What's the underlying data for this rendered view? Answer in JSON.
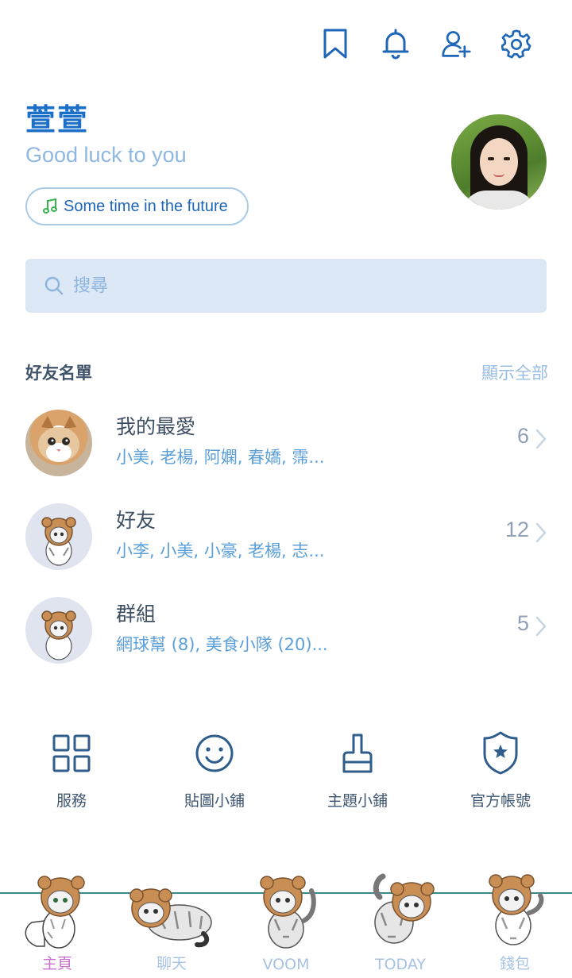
{
  "header": {
    "icons": [
      "bookmark-icon",
      "bell-icon",
      "add-friend-icon",
      "gear-icon"
    ]
  },
  "profile": {
    "name": "萱萱",
    "status": "Good luck to you",
    "music": "Some time in the future"
  },
  "search": {
    "placeholder": "搜尋"
  },
  "friends_section": {
    "title": "好友名單",
    "show_all": "顯示全部",
    "rows": [
      {
        "name": "我的最愛",
        "members": "小美, 老楊, 阿嫻, 春嬌, 霈...",
        "count": "6"
      },
      {
        "name": "好友",
        "members": "小李, 小美, 小豪, 老楊, 志...",
        "count": "12"
      },
      {
        "name": "群組",
        "members": "網球幫 (8), 美食小隊 (20)...",
        "count": "5"
      }
    ]
  },
  "shortcuts": [
    {
      "label": "服務",
      "icon": "grid-icon"
    },
    {
      "label": "貼圖小鋪",
      "icon": "smiley-icon"
    },
    {
      "label": "主題小鋪",
      "icon": "brush-icon"
    },
    {
      "label": "官方帳號",
      "icon": "shield-star-icon"
    }
  ],
  "tabs": [
    {
      "label": "主頁",
      "active": true
    },
    {
      "label": "聊天",
      "active": false
    },
    {
      "label": "VOOM",
      "active": false
    },
    {
      "label": "TODAY",
      "active": false
    },
    {
      "label": "錢包",
      "active": false
    }
  ],
  "colors": {
    "brand": "#1b6fc6",
    "accent_light": "#dce8f5",
    "active_tab": "#c86fd0",
    "inactive_tab": "#a7c3e3"
  }
}
